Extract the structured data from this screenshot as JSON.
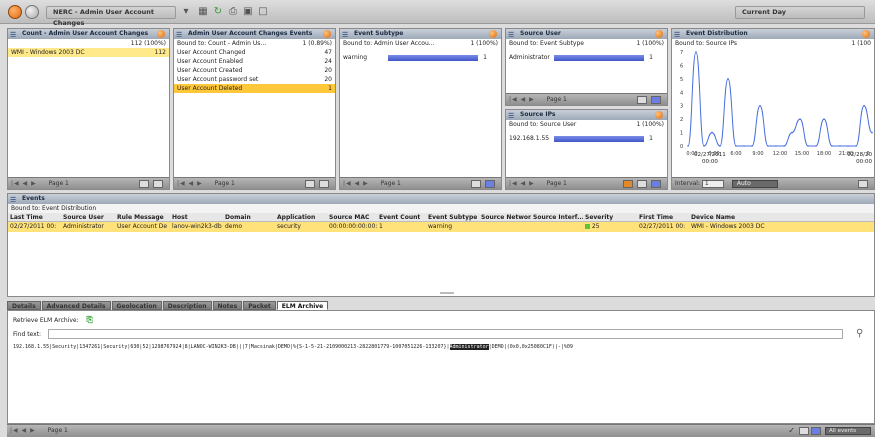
{
  "toolbar": {
    "title": "NERC - Admin User Account Changes",
    "period": "Current Day"
  },
  "count_panel": {
    "title": "Count - Admin User Account Changes",
    "total": "112 (100%)",
    "rows": [
      {
        "label": "WMI - Windows 2003 DC",
        "value": "112"
      }
    ],
    "page": "Page 1"
  },
  "events_panel": {
    "title": "Admin User Account Changes Events",
    "bound": "Bound to: Count - Admin Us...",
    "bound_value": "1 (0.89%)",
    "rows": [
      {
        "label": "User Account Changed",
        "value": "47"
      },
      {
        "label": "User Account Enabled",
        "value": "24"
      },
      {
        "label": "User Account Created",
        "value": "20"
      },
      {
        "label": "User Account password set",
        "value": "20"
      },
      {
        "label": "User Account Deleted",
        "value": "1"
      }
    ],
    "page": "Page 1"
  },
  "subtype_panel": {
    "title": "Event Subtype",
    "bound": "Bound to: Admin User Accou...",
    "bound_value": "1 (100%)",
    "rows": [
      {
        "label": "warning",
        "value": "1",
        "bar": 1.0
      }
    ],
    "page": "Page 1"
  },
  "source_user_panel": {
    "title": "Source User",
    "bound": "Bound to: Event Subtype",
    "bound_value": "1 (100%)",
    "rows": [
      {
        "label": "Administrator",
        "value": "1",
        "bar": 1.0
      }
    ],
    "page": "Page 1"
  },
  "source_ips_panel": {
    "title": "Source IPs",
    "bound": "Bound to: Source User",
    "bound_value": "1 (100%)",
    "rows": [
      {
        "label": "192.168.1.55",
        "value": "1",
        "bar": 1.0
      }
    ],
    "page": "Page 1"
  },
  "distribution_panel": {
    "title": "Event Distribution",
    "bound": "Bound to: Source IPs",
    "bound_value": "1 (100",
    "date_left": "02/27/2011",
    "time_left": "00:00",
    "date_right": "02/28/20",
    "time_right": "00:00",
    "interval_label": "Interval:",
    "interval_value": "1",
    "auto_label": "Auto"
  },
  "chart_data": {
    "type": "line",
    "x": [
      "0:00",
      "1:00",
      "2:00",
      "3:00",
      "4:00",
      "5:00",
      "6:00",
      "7:00",
      "8:00",
      "9:00",
      "10:00",
      "11:00",
      "12:00",
      "13:00",
      "14:00",
      "15:00",
      "16:00",
      "17:00",
      "18:00",
      "19:00",
      "20:00",
      "21:00",
      "22:00",
      "23:00"
    ],
    "values": [
      0,
      7,
      0,
      1,
      0,
      5,
      0,
      0,
      0,
      3,
      0,
      0,
      0,
      1,
      2,
      0,
      0,
      2,
      0,
      0,
      0,
      0,
      3,
      1
    ],
    "ylim": [
      0,
      7
    ],
    "y_ticks": [
      "0",
      "1",
      "2",
      "3",
      "4",
      "5",
      "6",
      "7"
    ],
    "x_ticks": [
      "0:00",
      "3:00",
      "6:00",
      "9:00",
      "12:00",
      "15:00",
      "18:00",
      "21:00",
      "0"
    ],
    "color": "#4a6fe0"
  },
  "events_table": {
    "title": "Events",
    "bound": "Bound to: Event Distribution",
    "headers": [
      "Last Time",
      "Source User",
      "Rule Message",
      "Host",
      "Domain",
      "Application",
      "Source MAC",
      "Event Count",
      "Event Subtype",
      "Source Networ...",
      "Source Interf...",
      "Severity",
      "First Time",
      "Device Name"
    ],
    "row": [
      "02/27/2011 00:",
      "Administrator",
      "User Account De",
      "lanov-win2k3-db",
      "demo",
      "security",
      "00:00:00:00:00:00",
      "1",
      "warning",
      "",
      "",
      "25",
      "02/27/2011 00:",
      "WMI - Windows 2003 DC"
    ],
    "severity_color": "#5cc43a"
  },
  "tabs": [
    "Details",
    "Advanced Details",
    "Geolocation",
    "Description",
    "Notes",
    "Packet",
    "ELM Archive"
  ],
  "elm": {
    "retrieve_label": "Retrieve ELM Archive:",
    "find_label": "Find text:",
    "raw_before": "192.168.1.55|Security|1347261|Security|630|52|1298767924|8|LANOC-WIN2K3-DB|||7|Macsinak|DEMO|%{S-1-5-21-2109000213-2822801779-1007051226-133207}|",
    "raw_highlight": "Administrator",
    "raw_after": "|DEMO|(0x0,0x25080C1F)|-|%09",
    "page": "Page 1",
    "footer_select": "All events"
  }
}
